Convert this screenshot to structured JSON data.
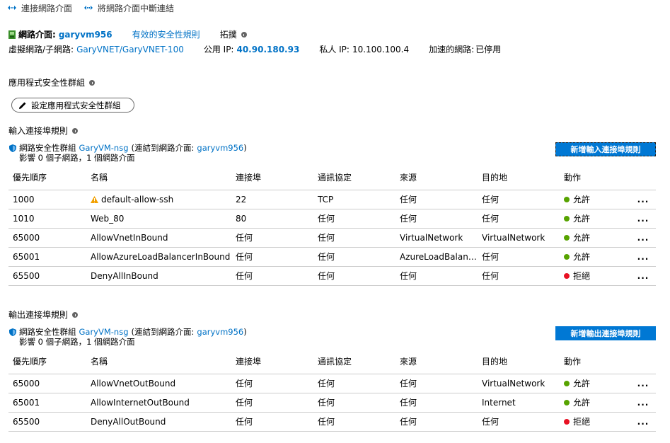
{
  "toolbar": {
    "attach_label": "連接網路介面",
    "detach_label": "將網路介面中斷連結"
  },
  "nic": {
    "label": "網路介面:",
    "name": "garyvm956",
    "effective_rules_link": "有效的安全性規則",
    "topology_label": "拓撲",
    "vnet_label": "虛擬網路/子網路:",
    "vnet_value": "GaryVNET/GaryVNET-100",
    "public_ip_label": "公用 IP:",
    "public_ip_value": "40.90.180.93",
    "private_ip_label": "私人 IP:",
    "private_ip_value": "10.100.100.4",
    "accel_label": "加速的網路:",
    "accel_value": "已停用"
  },
  "asg": {
    "title": "應用程式安全性群組",
    "configure_button": "設定應用程式安全性群組"
  },
  "inbound": {
    "title": "輸入連接埠規則",
    "nsg_prefix": "網路安全性群組",
    "nsg_name": "GaryVM-nsg",
    "nsg_attached_text": "(連結到網路介面:",
    "nsg_attached_nic": "garyvm956",
    "nsg_close": ")",
    "impact": "影響 0 個子網路，1 個網路介面",
    "add_button": "新增輸入連接埠規則",
    "columns": [
      "優先順序",
      "名稱",
      "連接埠",
      "通訊協定",
      "來源",
      "目的地",
      "動作"
    ],
    "rows": [
      {
        "priority": "1000",
        "name": "default-allow-ssh",
        "warning": true,
        "port": "22",
        "protocol": "TCP",
        "source": "任何",
        "destination": "任何",
        "action": "允許",
        "action_type": "allow"
      },
      {
        "priority": "1010",
        "name": "Web_80",
        "warning": false,
        "port": "80",
        "protocol": "任何",
        "source": "任何",
        "destination": "任何",
        "action": "允許",
        "action_type": "allow"
      },
      {
        "priority": "65000",
        "name": "AllowVnetInBound",
        "warning": false,
        "port": "任何",
        "protocol": "任何",
        "source": "VirtualNetwork",
        "destination": "VirtualNetwork",
        "action": "允許",
        "action_type": "allow"
      },
      {
        "priority": "65001",
        "name": "AllowAzureLoadBalancerInBound",
        "warning": false,
        "port": "任何",
        "protocol": "任何",
        "source": "AzureLoadBalanc...",
        "destination": "任何",
        "action": "允許",
        "action_type": "allow"
      },
      {
        "priority": "65500",
        "name": "DenyAllInBound",
        "warning": false,
        "port": "任何",
        "protocol": "任何",
        "source": "任何",
        "destination": "任何",
        "action": "拒絕",
        "action_type": "deny"
      }
    ]
  },
  "outbound": {
    "title": "輸出連接埠規則",
    "nsg_prefix": "網路安全性群組",
    "nsg_name": "GaryVM-nsg",
    "nsg_attached_text": "(連結到網路介面:",
    "nsg_attached_nic": "garyvm956",
    "nsg_close": ")",
    "impact": "影響 0 個子網路，1 個網路介面",
    "add_button": "新增輸出連接埠規則",
    "columns": [
      "優先順序",
      "名稱",
      "連接埠",
      "通訊協定",
      "來源",
      "目的地",
      "動作"
    ],
    "rows": [
      {
        "priority": "65000",
        "name": "AllowVnetOutBound",
        "warning": false,
        "port": "任何",
        "protocol": "任何",
        "source": "任何",
        "destination": "VirtualNetwork",
        "action": "允許",
        "action_type": "allow"
      },
      {
        "priority": "65001",
        "name": "AllowInternetOutBound",
        "warning": false,
        "port": "任何",
        "protocol": "任何",
        "source": "任何",
        "destination": "Internet",
        "action": "允許",
        "action_type": "allow"
      },
      {
        "priority": "65500",
        "name": "DenyAllOutBound",
        "warning": false,
        "port": "任何",
        "protocol": "任何",
        "source": "任何",
        "destination": "任何",
        "action": "拒絕",
        "action_type": "deny"
      }
    ]
  },
  "more_label": "...",
  "colors": {
    "link": "#0072c6",
    "primary_button": "#0078d4",
    "allow": "#57a300",
    "deny": "#e81123",
    "warning": "#f2a000"
  }
}
